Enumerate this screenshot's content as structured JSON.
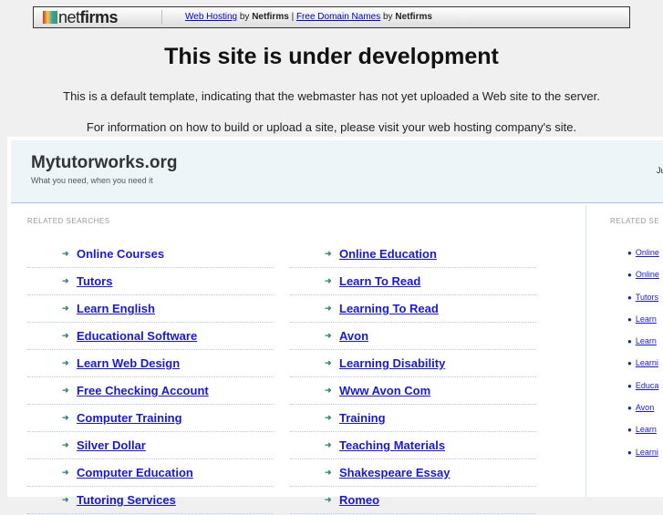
{
  "topbar": {
    "logo": "netfirms",
    "link1": "Web Hosting",
    "by1": "by",
    "brand1": "Netfirms",
    "pipe": "|",
    "link2": "Free Domain Names",
    "by2": "by",
    "brand2": "Netfirms"
  },
  "title": "This site is under development",
  "para1": "This is a default template, indicating that the webmaster has not yet uploaded a Web site to the server.",
  "para2": "For information on how to build or upload a site, please visit your web hosting company's site.",
  "site": {
    "name": "Mytutorworks.org",
    "tagline": "What you need, when you need it",
    "right_text": "Ju"
  },
  "related_label": "RELATED SEARCHES",
  "related_label_side": "RELATED SE",
  "col1": [
    "Online Courses",
    "Tutors",
    "Learn English",
    "Educational Software",
    "Learn Web Design",
    "Free Checking Account",
    "Computer Training",
    "Silver Dollar",
    "Computer Education",
    "Tutoring Services"
  ],
  "col2": [
    "Online Education",
    "Learn To Read",
    "Learning To Read",
    "Avon",
    "Learning Disability",
    "Www Avon Com",
    "Training",
    "Teaching Materials",
    "Shakespeare Essay",
    "Romeo"
  ],
  "side": [
    "Online",
    "Online",
    "Tutors",
    "Learn",
    "Learn",
    "Learni",
    "Educa",
    "Avon",
    "Learn",
    "Learni"
  ]
}
